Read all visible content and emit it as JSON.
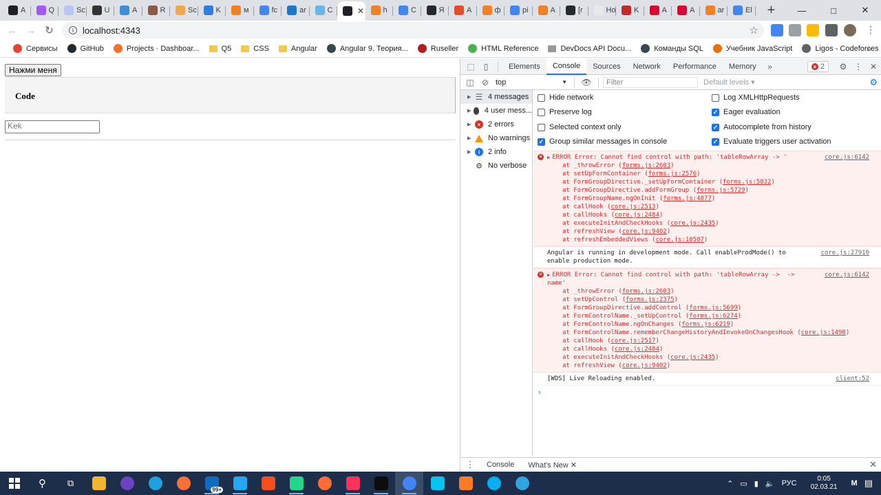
{
  "browser": {
    "tabs": [
      {
        "title": "A",
        "color": "#202124"
      },
      {
        "title": "Q",
        "color": "#a259ff"
      },
      {
        "title": "Sc",
        "color": "#b7c6f7"
      },
      {
        "title": "U",
        "color": "#333333"
      },
      {
        "title": "A",
        "color": "#3d8ed4"
      },
      {
        "title": "R",
        "color": "#8a5a44"
      },
      {
        "title": "Sc",
        "color": "#f6a54b"
      },
      {
        "title": "K",
        "color": "#2e7de1"
      },
      {
        "title": "м",
        "color": "#f48024"
      },
      {
        "title": "fc",
        "color": "#4285f4"
      },
      {
        "title": "ar",
        "color": "#1976d2"
      },
      {
        "title": "C",
        "color": "#69b4e8"
      },
      {
        "title": "",
        "color": "#202124",
        "active": true
      },
      {
        "title": "h",
        "color": "#f48024"
      },
      {
        "title": "C",
        "color": "#4285f4"
      },
      {
        "title": "Я",
        "color": "#24292e"
      },
      {
        "title": "A",
        "color": "#e44d26"
      },
      {
        "title": "ф",
        "color": "#f48024"
      },
      {
        "title": "pi",
        "color": "#4285f4"
      },
      {
        "title": "A",
        "color": "#f48024"
      },
      {
        "title": "[r",
        "color": "#24292e"
      },
      {
        "title": "Нова",
        "color": "#e8e8e8"
      },
      {
        "title": "K",
        "color": "#c62828"
      },
      {
        "title": "A",
        "color": "#dd0031"
      },
      {
        "title": "A",
        "color": "#dd0031"
      },
      {
        "title": "ar",
        "color": "#f48024"
      },
      {
        "title": "El",
        "color": "#4285f4"
      }
    ],
    "new_tab": "+",
    "url": "localhost:4343",
    "bookmarks": [
      {
        "label": "Сервисы",
        "icon": "apps-grid-icon",
        "color": "#e94235",
        "folder": false
      },
      {
        "label": "GitHub",
        "icon": "github-icon",
        "color": "#24292e",
        "folder": false
      },
      {
        "label": "Projects · Dashboar...",
        "icon": "gitlab-icon",
        "color": "#fc6d26",
        "folder": false
      },
      {
        "label": "Q5",
        "icon": "folder-icon",
        "color": "#f2c94c",
        "folder": true
      },
      {
        "label": "CSS",
        "icon": "folder-icon",
        "color": "#f2c94c",
        "folder": true
      },
      {
        "label": "Angular",
        "icon": "folder-icon",
        "color": "#f2c94c",
        "folder": true
      },
      {
        "label": "Angular 9. Теория...",
        "icon": "globe-icon",
        "color": "#37474f",
        "folder": false
      },
      {
        "label": "Ruseller",
        "icon": "ruseller-icon",
        "color": "#b71c1c",
        "folder": false
      },
      {
        "label": "HTML Reference",
        "icon": "w-icon",
        "color": "#4caf50",
        "folder": false
      },
      {
        "label": "DevDocs API Docu...",
        "icon": "devdocs-icon",
        "color": "#999999",
        "folder": true
      },
      {
        "label": "Команды SQL",
        "icon": "globe-icon",
        "color": "#37474f",
        "folder": false
      },
      {
        "label": "Учебник JavaScript",
        "icon": "js-icon",
        "color": "#e8710a",
        "folder": false
      },
      {
        "label": "Ligos - Codeforces",
        "icon": "globe-icon",
        "color": "#5f6368",
        "folder": false
      }
    ]
  },
  "page": {
    "button_label": "Нажми меня",
    "code_title": "Code",
    "input_value": "Kek"
  },
  "devtools": {
    "tabs": [
      "Elements",
      "Console",
      "Sources",
      "Network",
      "Performance",
      "Memory"
    ],
    "active_tab": "Console",
    "error_count": "2",
    "context": "top",
    "filter_placeholder": "Filter",
    "levels": "Default levels ▾",
    "sidebar": [
      {
        "label": "4 messages",
        "icon": "list-icon"
      },
      {
        "label": "4 user mess...",
        "icon": "user-icon"
      },
      {
        "label": "2 errors",
        "icon": "error-icon"
      },
      {
        "label": "No warnings",
        "icon": "warning-icon"
      },
      {
        "label": "2 info",
        "icon": "info-icon"
      },
      {
        "label": "No verbose",
        "icon": "bug-icon"
      }
    ],
    "settings": {
      "hide_network": "Hide network",
      "preserve_log": "Preserve log",
      "selected_context": "Selected context only",
      "group_similar": "Group similar messages in console",
      "log_xhr": "Log XMLHttpRequests",
      "eager_eval": "Eager evaluation",
      "autocomplete": "Autocomplete from history",
      "eval_triggers": "Evaluate triggers user activation"
    },
    "messages": [
      {
        "type": "error",
        "text": "ERROR Error: Cannot find control with path: 'tableRowArray -> '",
        "source": "core.js:6142",
        "stack": [
          [
            "at _throwError (",
            "forms.js:2603",
            ")"
          ],
          [
            "at setUpFormContainer (",
            "forms.js:2576",
            ")"
          ],
          [
            "at FormGroupDirective._setUpFormContainer (",
            "forms.js:5832",
            ")"
          ],
          [
            "at FormGroupDirective.addFormGroup (",
            "forms.js:5729",
            ")"
          ],
          [
            "at FormGroupName.ngOnInit (",
            "forms.js:4877",
            ")"
          ],
          [
            "at callHook (",
            "core.js:2513",
            ")"
          ],
          [
            "at callHooks (",
            "core.js:2484",
            ")"
          ],
          [
            "at executeInitAndCheckHooks (",
            "core.js:2435",
            ")"
          ],
          [
            "at refreshView (",
            "core.js:9402",
            ")"
          ],
          [
            "at refreshEmbeddedViews (",
            "core.js:10507",
            ")"
          ]
        ]
      },
      {
        "type": "log",
        "text": "Angular is running in development mode. Call enableProdMode() to enable production mode.",
        "source": "core.js:27910",
        "stack": []
      },
      {
        "type": "error",
        "text": "ERROR Error: Cannot find control with path: 'tableRowArray ->  -> name'",
        "source": "core.js:6142",
        "stack": [
          [
            "at _throwError (",
            "forms.js:2603",
            ")"
          ],
          [
            "at setUpControl (",
            "forms.js:2375",
            ")"
          ],
          [
            "at FormGroupDirective.addControl (",
            "forms.js:5699",
            ")"
          ],
          [
            "at FormControlName._setUpControl (",
            "forms.js:6274",
            ")"
          ],
          [
            "at FormControlName.ngOnChanges (",
            "forms.js:6219",
            ")"
          ],
          [
            "at FormControlName.rememberChangeHistoryAndInvokeOnChangesHook (",
            "core.js:1498",
            ")"
          ],
          [
            "at callHook (",
            "core.js:2517",
            ")"
          ],
          [
            "at callHooks (",
            "core.js:2484",
            ")"
          ],
          [
            "at executeInitAndCheckHooks (",
            "core.js:2435",
            ")"
          ],
          [
            "at refreshView (",
            "core.js:9402",
            ")"
          ]
        ]
      },
      {
        "type": "log",
        "text": "[WDS] Live Reloading enabled.",
        "source": "client:52",
        "stack": []
      }
    ],
    "drawer_tabs": [
      "Console",
      "What's New"
    ]
  },
  "taskbar": {
    "apps": [
      {
        "icon": "file-explorer-icon",
        "color": "#f2b632"
      },
      {
        "icon": "github-desktop-icon",
        "color": "#6f42c1"
      },
      {
        "icon": "edge-icon",
        "color": "#1fa0e0"
      },
      {
        "icon": "firefox-icon",
        "color": "#ff7139"
      },
      {
        "icon": "mail-icon",
        "color": "#0f6cbd"
      },
      {
        "icon": "vscode-icon",
        "color": "#23a9f2"
      },
      {
        "icon": "figma-icon",
        "color": "#f24e1e"
      },
      {
        "icon": "pycharm-icon",
        "color": "#21d789"
      },
      {
        "icon": "postman-icon",
        "color": "#ff6c37"
      },
      {
        "icon": "intellij-icon",
        "color": "#fe315d"
      },
      {
        "icon": "terminal-icon",
        "color": "#0c0c0c"
      },
      {
        "icon": "chrome-icon",
        "color": "#4285f4"
      },
      {
        "icon": "webstorm-icon",
        "color": "#07c3f2"
      },
      {
        "icon": "xampp-icon",
        "color": "#fb7a24"
      },
      {
        "icon": "skype-icon",
        "color": "#00aff0"
      },
      {
        "icon": "telegram-icon",
        "color": "#2ca5e0"
      }
    ],
    "mail_badge": "99+",
    "lang": "РУС",
    "time": "0:05",
    "date": "02.03.21"
  }
}
